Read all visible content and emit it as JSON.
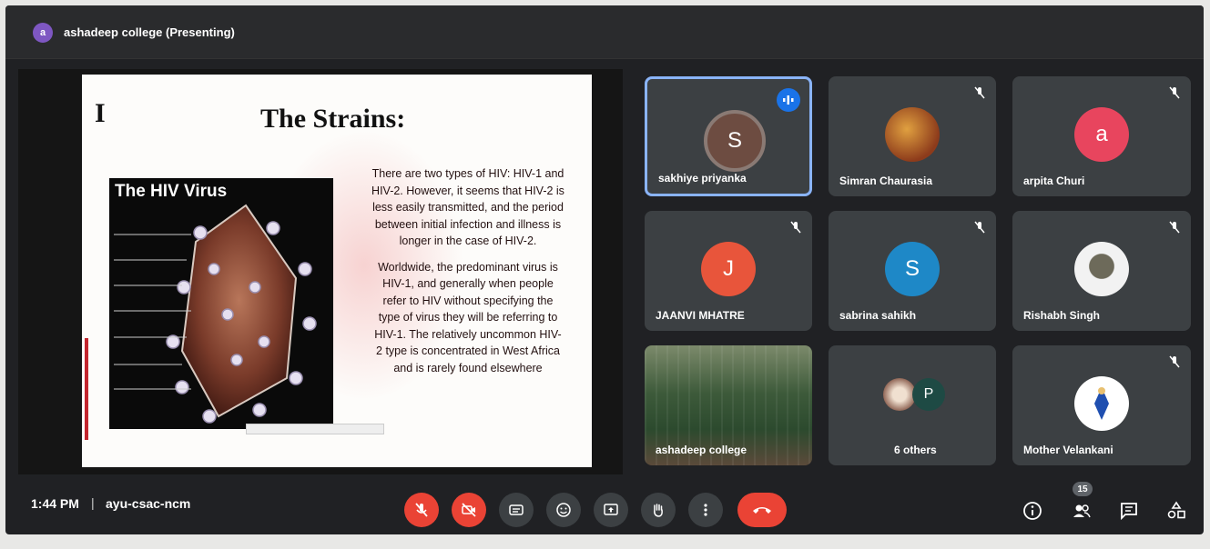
{
  "header": {
    "presenter_initial": "a",
    "presenting_title": "ashadeep college (Presenting)"
  },
  "slide": {
    "left_letter": "I",
    "title": "The Strains:",
    "image_title": "The HIV Virus",
    "paragraph1": "There are two types of HIV: HIV-1 and HIV-2. However, it seems that HIV-2 is less easily transmitted, and the period between initial infection and illness is longer in the case of HIV-2.",
    "paragraph2": "Worldwide, the predominant virus is HIV-1, and generally when people refer to HIV without specifying the type of virus they will be referring to HIV-1. The relatively uncommon HIV-2 type is concentrated in West Africa and is rarely found elsewhere"
  },
  "participants": [
    {
      "name": "sakhiye priyanka",
      "initial": "S",
      "color": "#6d4c41",
      "speaking": true
    },
    {
      "name": "Simran Chaurasia",
      "initial": "",
      "color": "#8d5a3b",
      "muted": true
    },
    {
      "name": "arpita Churi",
      "initial": "a",
      "color": "#e8455e",
      "muted": true
    },
    {
      "name": "JAANVI MHATRE",
      "initial": "J",
      "color": "#e8553b",
      "muted": true
    },
    {
      "name": "sabrina sahikh",
      "initial": "S",
      "color": "#1e88c7",
      "muted": true
    },
    {
      "name": "Rishabh Singh",
      "initial": "",
      "color": "#f2f2f2",
      "muted": true
    },
    {
      "name": "ashadeep college",
      "initial": "",
      "color": "#3d5a3a"
    },
    {
      "name": "6 others",
      "initial": "P",
      "color": "#1e4a44"
    },
    {
      "name": "Mother Velankani",
      "initial": "",
      "color": "#ffffff",
      "muted": true
    }
  ],
  "bottom": {
    "time": "1:44 PM",
    "separator": "|",
    "meeting_code": "ayu-csac-ncm",
    "people_count": "15"
  },
  "icons": {
    "mic": "mic-off-icon",
    "camera": "camera-off-icon",
    "captions": "captions-icon",
    "emoji": "emoji-icon",
    "present": "present-screen-icon",
    "hand": "raise-hand-icon",
    "more": "more-options-icon",
    "end": "end-call-icon",
    "info": "info-icon",
    "people": "people-icon",
    "chat": "chat-icon",
    "activities": "activities-icon"
  },
  "colors": {
    "accent_red": "#ea4335",
    "active_border": "#8ab4f8",
    "tile_bg": "#3c4043"
  }
}
